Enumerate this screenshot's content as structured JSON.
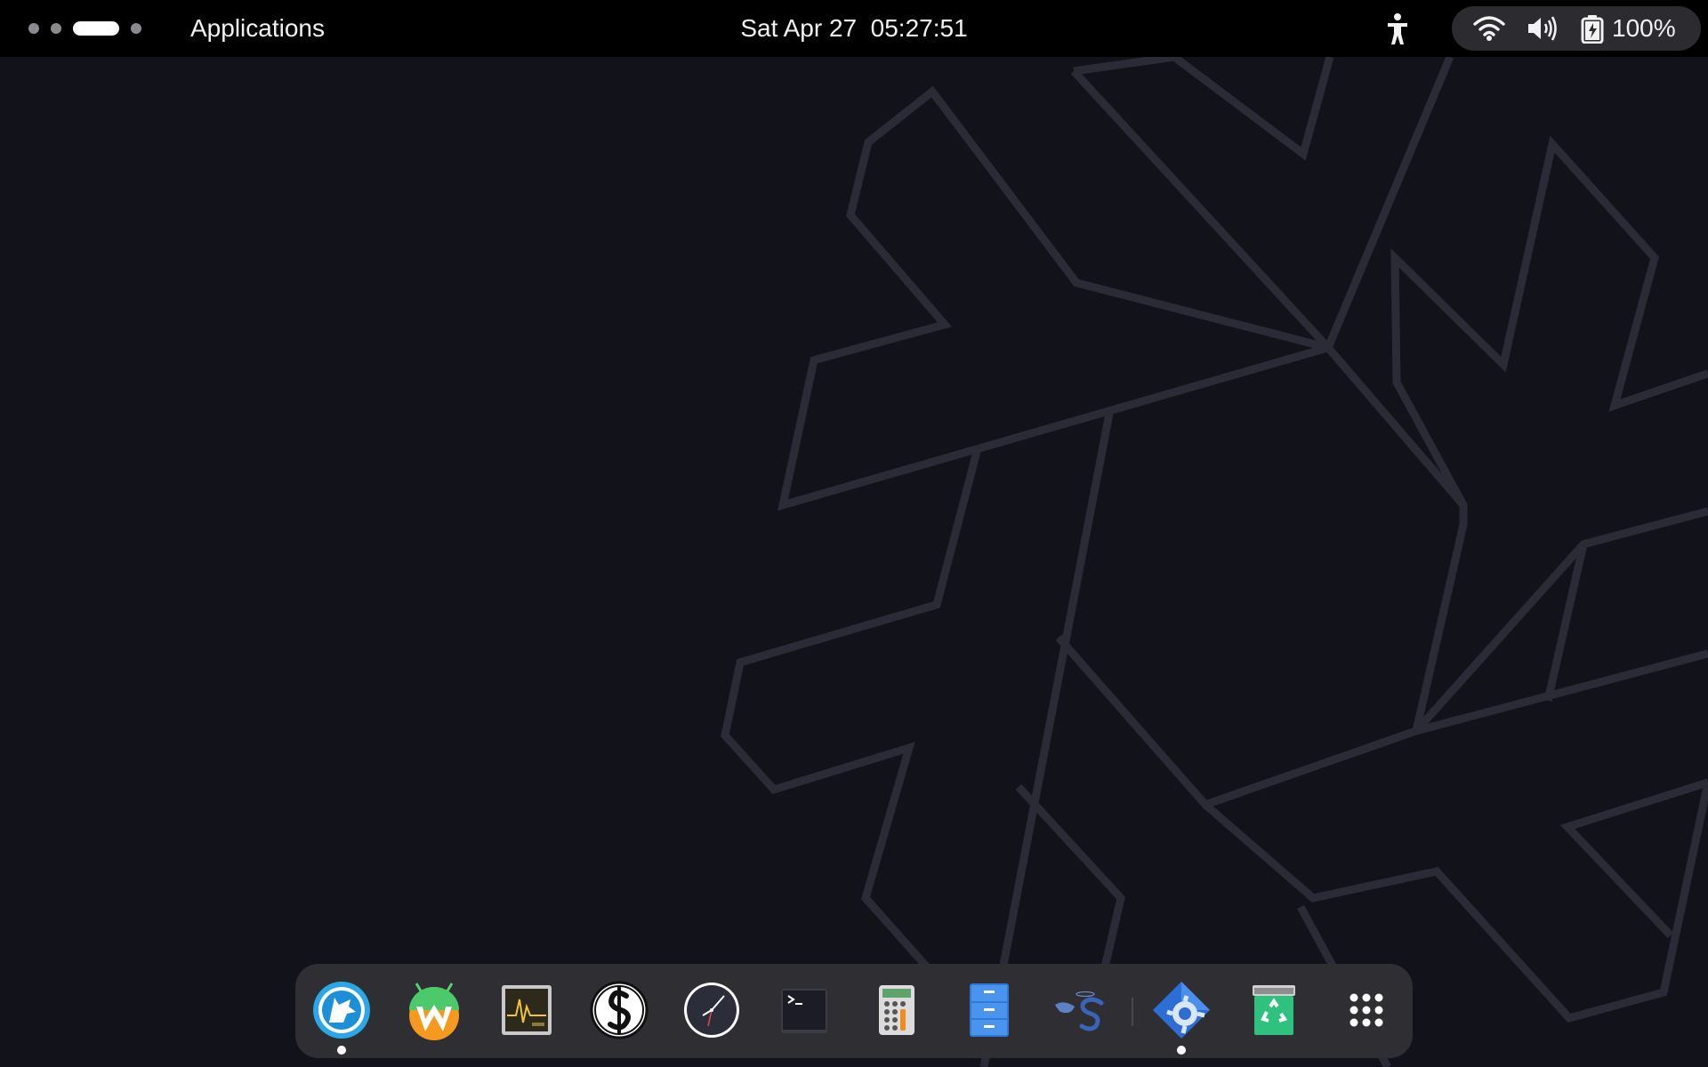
{
  "top_bar": {
    "activities_label": "Applications",
    "date": "Sat Apr 27",
    "time": "05:27:51",
    "workspaces": {
      "count": 4,
      "active_index": 2
    },
    "accessibility_icon": "accessibility-icon",
    "status": {
      "wifi_icon": "wifi-icon",
      "volume_icon": "volume-icon",
      "battery_icon": "battery-charging-icon",
      "battery_label": "100%"
    }
  },
  "dock": {
    "items": [
      {
        "name": "Web browser",
        "icon": "wolf-browser-icon",
        "running": true
      },
      {
        "name": "Android app",
        "icon": "android-w-icon",
        "running": false
      },
      {
        "name": "System Monitor",
        "icon": "system-monitor-icon",
        "running": false
      },
      {
        "name": "Font app",
        "icon": "font-s-icon",
        "running": false
      },
      {
        "name": "Clocks",
        "icon": "clock-icon",
        "running": false
      },
      {
        "name": "Terminal",
        "icon": "terminal-icon",
        "running": false
      },
      {
        "name": "Calculator",
        "icon": "calculator-icon",
        "running": false
      },
      {
        "name": "Files",
        "icon": "file-cabinet-icon",
        "running": false
      },
      {
        "name": "App",
        "icon": "bird-s-icon",
        "running": false
      },
      {
        "name": "Settings",
        "icon": "settings-gear-icon",
        "running": true
      },
      {
        "name": "Trash",
        "icon": "trash-icon",
        "running": false
      }
    ],
    "show_apps_icon": "app-grid-icon"
  },
  "colors": {
    "wallpaper_bg": "#12121b",
    "wallpaper_lines": "#2b2b38",
    "top_bar_bg": "#000000",
    "dock_bg": "#2e2e33",
    "status_pill_bg": "#2b2b30"
  }
}
